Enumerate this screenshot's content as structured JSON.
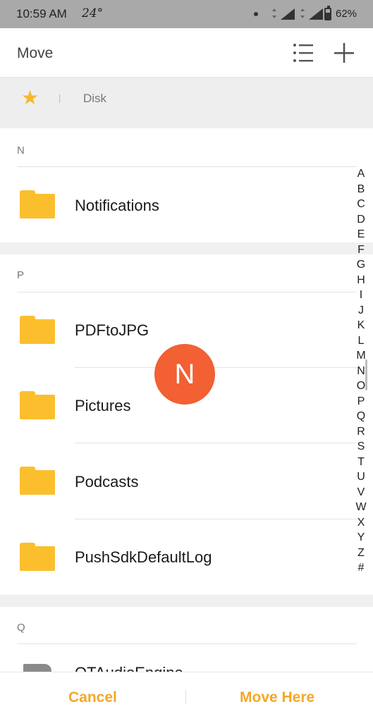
{
  "status_bar": {
    "time": "10:59 AM",
    "temperature": "24°",
    "battery_percent": "62%",
    "battery_level": 0.62
  },
  "header": {
    "title": "Move",
    "list_view_icon": "list-view-icon",
    "add_icon": "plus-icon"
  },
  "breadcrumb": {
    "favorite_icon": "star-icon",
    "location": "Disk"
  },
  "sections": [
    {
      "letter": "N",
      "items": [
        "Notifications"
      ]
    },
    {
      "letter": "P",
      "items": [
        "PDFtoJPG",
        "Pictures",
        "Podcasts",
        "PushSdkDefaultLog"
      ]
    },
    {
      "letter": "Q",
      "items": [
        "QTAudioEngine"
      ]
    }
  ],
  "index_letters": [
    "A",
    "B",
    "C",
    "D",
    "E",
    "F",
    "G",
    "H",
    "I",
    "J",
    "K",
    "L",
    "M",
    "N",
    "O",
    "P",
    "Q",
    "R",
    "S",
    "T",
    "U",
    "V",
    "W",
    "X",
    "Y",
    "Z",
    "#"
  ],
  "current_letter": "N",
  "footer": {
    "cancel_label": "Cancel",
    "move_label": "Move Here"
  },
  "colors": {
    "accent": "#f3a925",
    "folder": "#fbbf2e",
    "bubble": "#f26034"
  }
}
